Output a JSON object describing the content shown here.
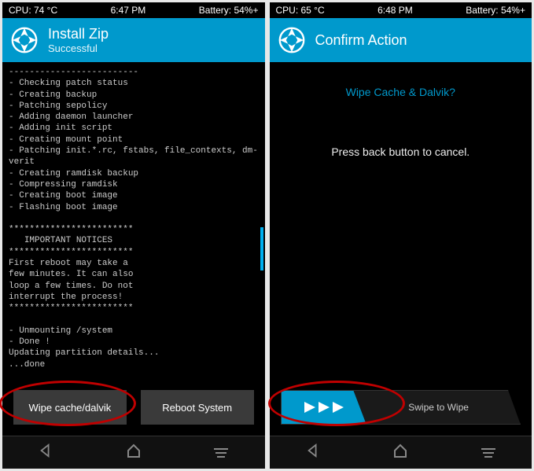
{
  "left": {
    "status": {
      "cpu": "CPU: 74 °C",
      "time": "6:47 PM",
      "battery": "Battery: 54%+"
    },
    "header": {
      "title": "Install Zip",
      "subtitle": "Successful"
    },
    "terminal": "-------------------------\n- Checking patch status\n- Creating backup\n- Patching sepolicy\n- Adding daemon launcher\n- Adding init script\n- Creating mount point\n- Patching init.*.rc, fstabs, file_contexts, dm-verit\n- Creating ramdisk backup\n- Compressing ramdisk\n- Creating boot image\n- Flashing boot image\n\n************************\n   IMPORTANT NOTICES\n************************\nFirst reboot may take a\nfew minutes. It can also\nloop a few times. Do not\ninterrupt the process!\n************************\n\n- Unmounting /system\n- Done !\nUpdating partition details...\n...done",
    "buttons": {
      "wipe": "Wipe cache/dalvik",
      "reboot": "Reboot System"
    }
  },
  "right": {
    "status": {
      "cpu": "CPU: 65 °C",
      "time": "6:48 PM",
      "battery": "Battery: 54%+"
    },
    "header": {
      "title": "Confirm Action",
      "subtitle": ""
    },
    "confirm": {
      "question": "Wipe Cache & Dalvik?",
      "hint": "Press back button to cancel."
    },
    "swipe": {
      "label": "Swipe to Wipe"
    }
  }
}
